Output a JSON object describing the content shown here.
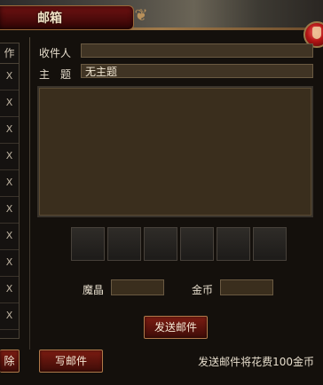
{
  "window": {
    "title": "邮箱"
  },
  "sidebar": {
    "header": "作",
    "rows": [
      "X",
      "X",
      "X",
      "X",
      "X",
      "X",
      "X",
      "X",
      "X",
      "X",
      "X"
    ]
  },
  "compose": {
    "recipient_label": "收件人",
    "recipient_value": "",
    "subject_label": "主　题",
    "subject_value": "无主题",
    "body_value": "",
    "attachment_slots": 6
  },
  "currency": {
    "crystal_label": "魔晶",
    "crystal_value": "",
    "gold_label": "金币",
    "gold_value": ""
  },
  "buttons": {
    "send": "发送邮件",
    "write": "写邮件",
    "delete_partial": "除"
  },
  "footer": {
    "cost_note": "发送邮件将花费100金币"
  },
  "colors": {
    "title_plate": "#4a0a0a",
    "button_red": "#5a130c",
    "field_bg": "#403424",
    "border_gold": "#b07a4a"
  }
}
